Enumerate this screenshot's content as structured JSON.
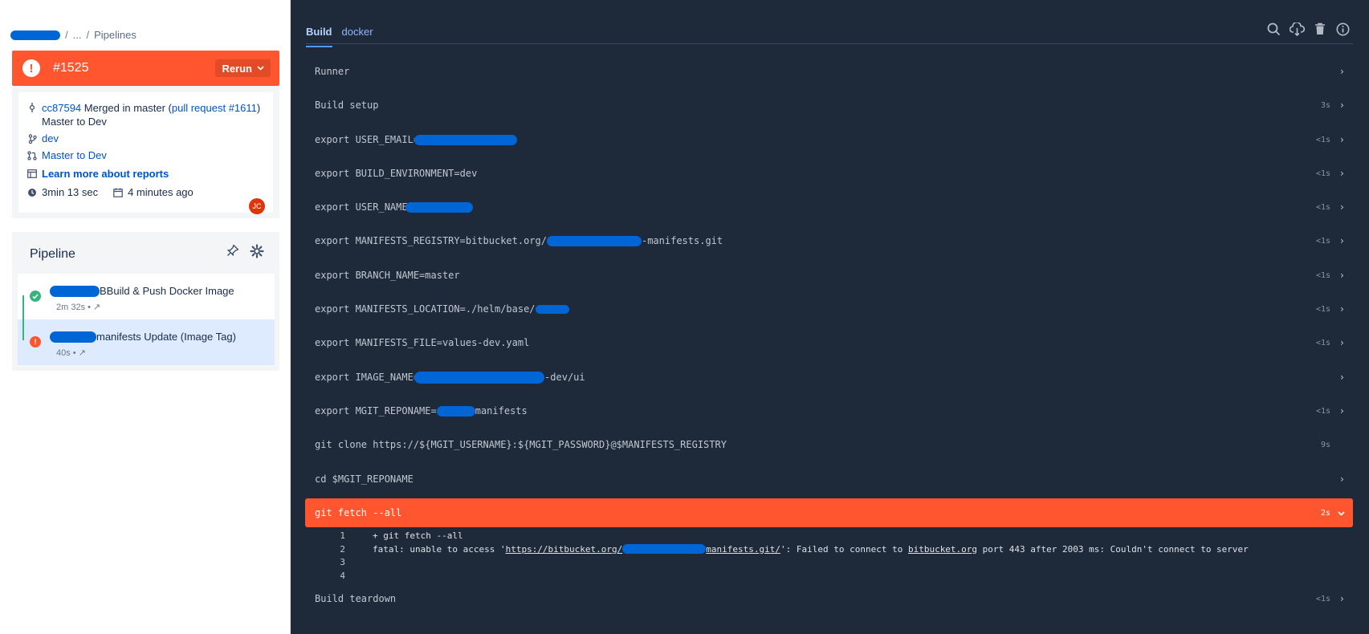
{
  "breadcrumb": {
    "ellipsis": "...",
    "sep": "/",
    "current": "Pipelines"
  },
  "build": {
    "number": "#1525",
    "rerun_label": "Rerun",
    "error_mark": "!"
  },
  "commit": {
    "hash": "cc87594",
    "message_pre": "Merged in master (",
    "pr_link": "pull request #1611",
    "message_post": ")",
    "message_line2": "Master to Dev",
    "branch": "dev",
    "pr_title": "Master to Dev",
    "reports_link": "Learn more about reports",
    "duration": "3min 13 sec",
    "time_ago": "4 minutes ago",
    "avatar_initials": "JC"
  },
  "pipeline": {
    "title": "Pipeline",
    "steps": [
      {
        "name": "Build & Push Docker Image",
        "prefix": "B",
        "meta": "2m 32s  •  ↗",
        "status": "success"
      },
      {
        "name": "manifests Update (Image Tag)",
        "prefix": "",
        "meta": "40s  •  ↗",
        "status": "failed"
      }
    ]
  },
  "tabs": [
    "Build",
    "docker"
  ],
  "toolbar_icons": [
    "search-icon",
    "download-icon",
    "trash-icon",
    "info-icon"
  ],
  "log": [
    {
      "pre": "Runner",
      "post": "",
      "dur": ""
    },
    {
      "pre": "Build setup",
      "post": "",
      "dur": "3s"
    },
    {
      "pre": "export USER_EMAIL=",
      "post": "",
      "dur": "<1s"
    },
    {
      "pre": "export BUILD_ENVIRONMENT=dev",
      "post": "",
      "dur": "<1s"
    },
    {
      "pre": "export USER_NAME=",
      "post": "",
      "dur": "<1s"
    },
    {
      "pre": "export MANIFESTS_REGISTRY=bitbucket.org/",
      "post": "-manifests.git",
      "dur": "<1s"
    },
    {
      "pre": "export BRANCH_NAME=master",
      "post": "",
      "dur": "<1s"
    },
    {
      "pre": "export MANIFESTS_LOCATION=./helm/base/",
      "post": "",
      "dur": "<1s"
    },
    {
      "pre": "export MANIFESTS_FILE=values-dev.yaml",
      "post": "",
      "dur": "<1s"
    },
    {
      "pre": "export IMAGE_NAME=",
      "post": "-dev/ui",
      "dur": ""
    },
    {
      "pre": "export MGIT_REPONAME=",
      "post": "manifests",
      "dur": "<1s"
    },
    {
      "pre": "git clone https://${MGIT_USERNAME}:${MGIT_PASSWORD}@$MANIFESTS_REGISTRY",
      "post": "",
      "dur": "9s"
    },
    {
      "pre": "cd $MGIT_REPONAME",
      "post": "",
      "dur": ""
    },
    {
      "pre": "git fetch --all",
      "post": "",
      "dur": "2s"
    },
    {
      "pre": "Build teardown",
      "post": "",
      "dur": "<1s"
    }
  ],
  "output": [
    {
      "n": "1",
      "text": "+ git fetch --all"
    },
    {
      "n": "2",
      "a": "fatal: unable to access '",
      "url1": "https://bitbucket.org/",
      "url2": "manifests.git/",
      "b": "': Failed to connect to ",
      "host": "bitbucket.org",
      "c": " port 443 after 2003 ms: Couldn't connect to server"
    },
    {
      "n": "3",
      "text": ""
    },
    {
      "n": "4",
      "text": ""
    }
  ],
  "colors": {
    "error": "#ff5630",
    "success": "#36b37e",
    "link": "#0052cc",
    "log_bg": "#1e2a3a"
  }
}
